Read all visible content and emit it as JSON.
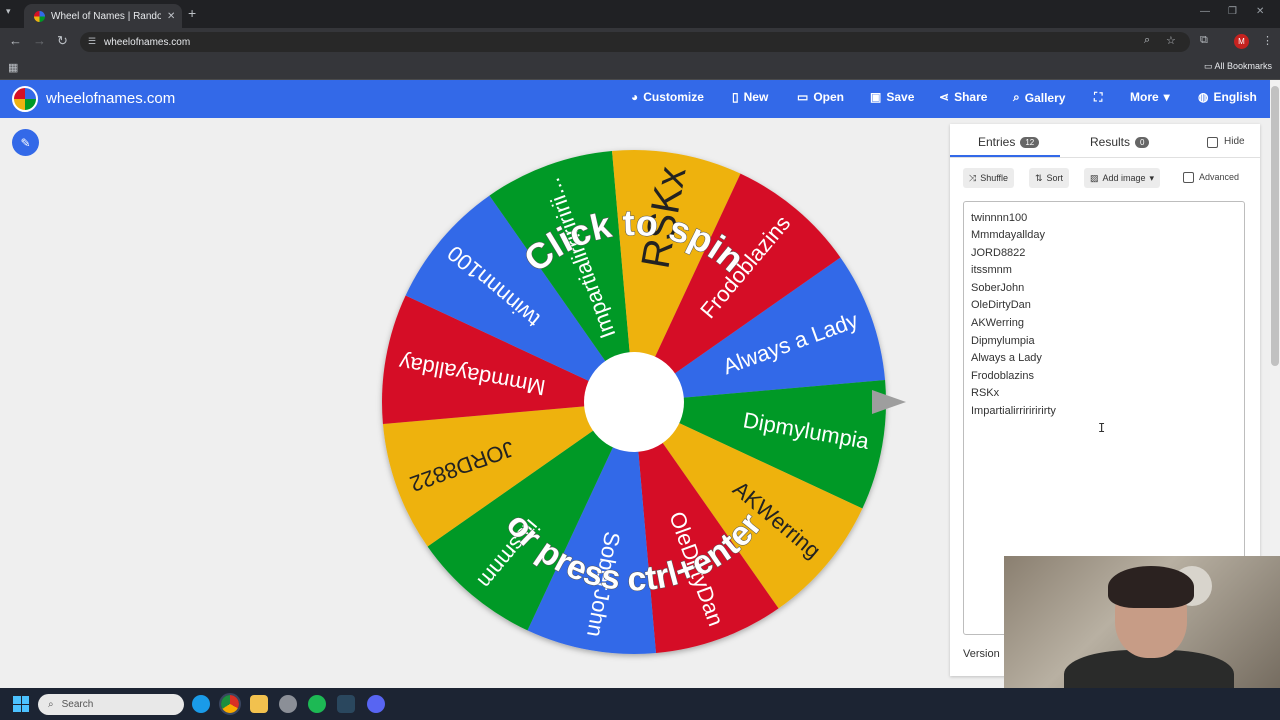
{
  "browser": {
    "tab_title": "Wheel of Names | Random name picker",
    "url": "wheelofnames.com",
    "bookmarks_label": "All Bookmarks",
    "profile_initial": "M"
  },
  "site": {
    "name": "wheelofnames.com",
    "menu": [
      {
        "label": "Customize",
        "icon": "palette-icon"
      },
      {
        "label": "New",
        "icon": "file-icon"
      },
      {
        "label": "Open",
        "icon": "folder-icon"
      },
      {
        "label": "Save",
        "icon": "save-icon"
      },
      {
        "label": "Share",
        "icon": "share-icon"
      },
      {
        "label": "Gallery",
        "icon": "search-icon"
      },
      {
        "label": "",
        "icon": "fullscreen-icon"
      },
      {
        "label": "More",
        "icon": "chevron-down-icon"
      },
      {
        "label": "English",
        "icon": "globe-icon"
      }
    ]
  },
  "wheel": {
    "spin_text_top": "Click to spin",
    "spin_text_bottom": "or press ctrl+enter",
    "colors": [
      "#3369e8",
      "#d50f25",
      "#eeb211",
      "#009925"
    ],
    "segments": [
      {
        "label": "Always a Lady",
        "color": "#3369e8"
      },
      {
        "label": "Dipmylumpia",
        "color": "#009925"
      },
      {
        "label": "AKWerring",
        "color": "#eeb211"
      },
      {
        "label": "OleDirtyDan",
        "color": "#d50f25"
      },
      {
        "label": "SoberJohn",
        "color": "#3369e8"
      },
      {
        "label": "itssmnm",
        "color": "#009925"
      },
      {
        "label": "JORD8822",
        "color": "#eeb211"
      },
      {
        "label": "Mmmdayallday",
        "color": "#d50f25"
      },
      {
        "label": "twinnnn100",
        "color": "#3369e8"
      },
      {
        "label": "Impartialirririririi...",
        "color": "#009925"
      },
      {
        "label": "RSKx",
        "color": "#eeb211"
      },
      {
        "label": "Frodoblazins",
        "color": "#d50f25"
      }
    ]
  },
  "panel": {
    "tab_entries": "Entries",
    "entries_count": "12",
    "tab_results": "Results",
    "results_count": "0",
    "hide_label": "Hide",
    "shuffle_label": "Shuffle",
    "sort_label": "Sort",
    "add_image_label": "Add image",
    "advanced_label": "Advanced",
    "entries": [
      "twinnnn100",
      "Mmmdayallday",
      "JORD8822",
      "itssmnm",
      "SoberJohn",
      "OleDirtyDan",
      "AKWerring",
      "Dipmylumpia",
      "Always a Lady",
      "Frodoblazins",
      "RSKx",
      "Impartialirririririrty"
    ],
    "version_label": "Version"
  },
  "taskbar": {
    "search_placeholder": "Search"
  }
}
